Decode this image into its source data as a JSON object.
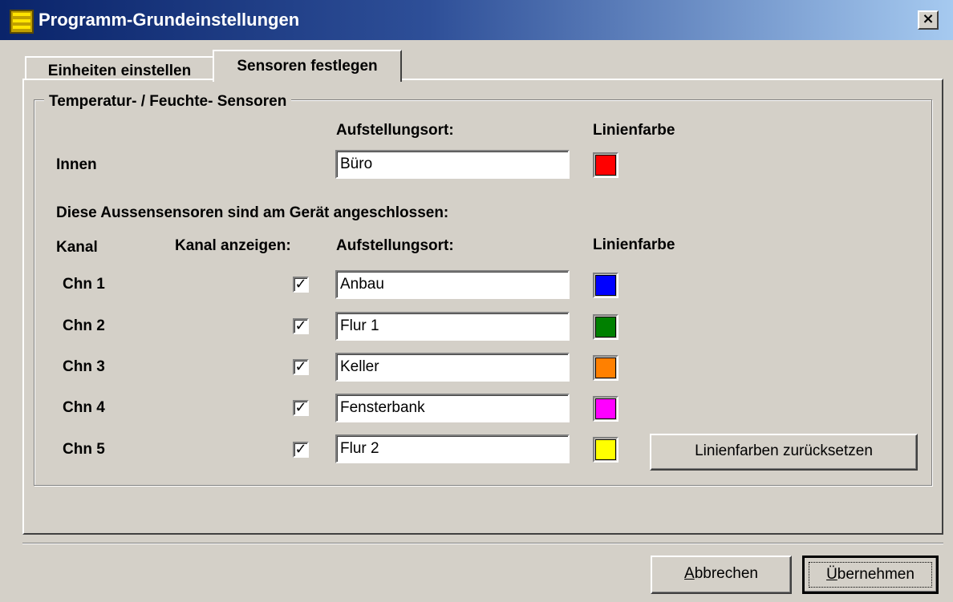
{
  "window": {
    "title": "Programm-Grundeinstellungen",
    "close_glyph": "×",
    "icon": "app-icon"
  },
  "tabs": [
    {
      "label": "Einheiten einstellen",
      "active": false
    },
    {
      "label": "Sensoren festlegen",
      "active": true
    }
  ],
  "group": {
    "title": "Temperatur- / Feuchte- Sensoren",
    "location_header": "Aufstellungsort:",
    "color_header": "Linienfarbe",
    "indoor": {
      "label": "Innen",
      "location": "Büro",
      "color": "#ff0000"
    },
    "outdoor_caption": "Diese Aussensensoren sind am Gerät angeschlossen:",
    "channel_header": "Kanal",
    "show_channel_header": "Kanal anzeigen:",
    "channels": [
      {
        "label": "Chn 1",
        "checked": true,
        "check_glyph": "✓",
        "location": "Anbau",
        "color": "#0000ff"
      },
      {
        "label": "Chn 2",
        "checked": true,
        "check_glyph": "✓",
        "location": "Flur 1",
        "color": "#008000"
      },
      {
        "label": "Chn 3",
        "checked": true,
        "check_glyph": "✓",
        "location": "Keller",
        "color": "#ff8000"
      },
      {
        "label": "Chn 4",
        "checked": true,
        "check_glyph": "✓",
        "location": "Fensterbank",
        "color": "#ff00ff"
      },
      {
        "label": "Chn 5",
        "checked": true,
        "check_glyph": "✓",
        "location": "Flur 2",
        "color": "#ffff00"
      }
    ],
    "reset_button": "Linienfarben zurücksetzen"
  },
  "footer": {
    "cancel_accel": "A",
    "cancel_rest": "bbrechen",
    "apply_accel": "Ü",
    "apply_rest": "bernehmen"
  }
}
